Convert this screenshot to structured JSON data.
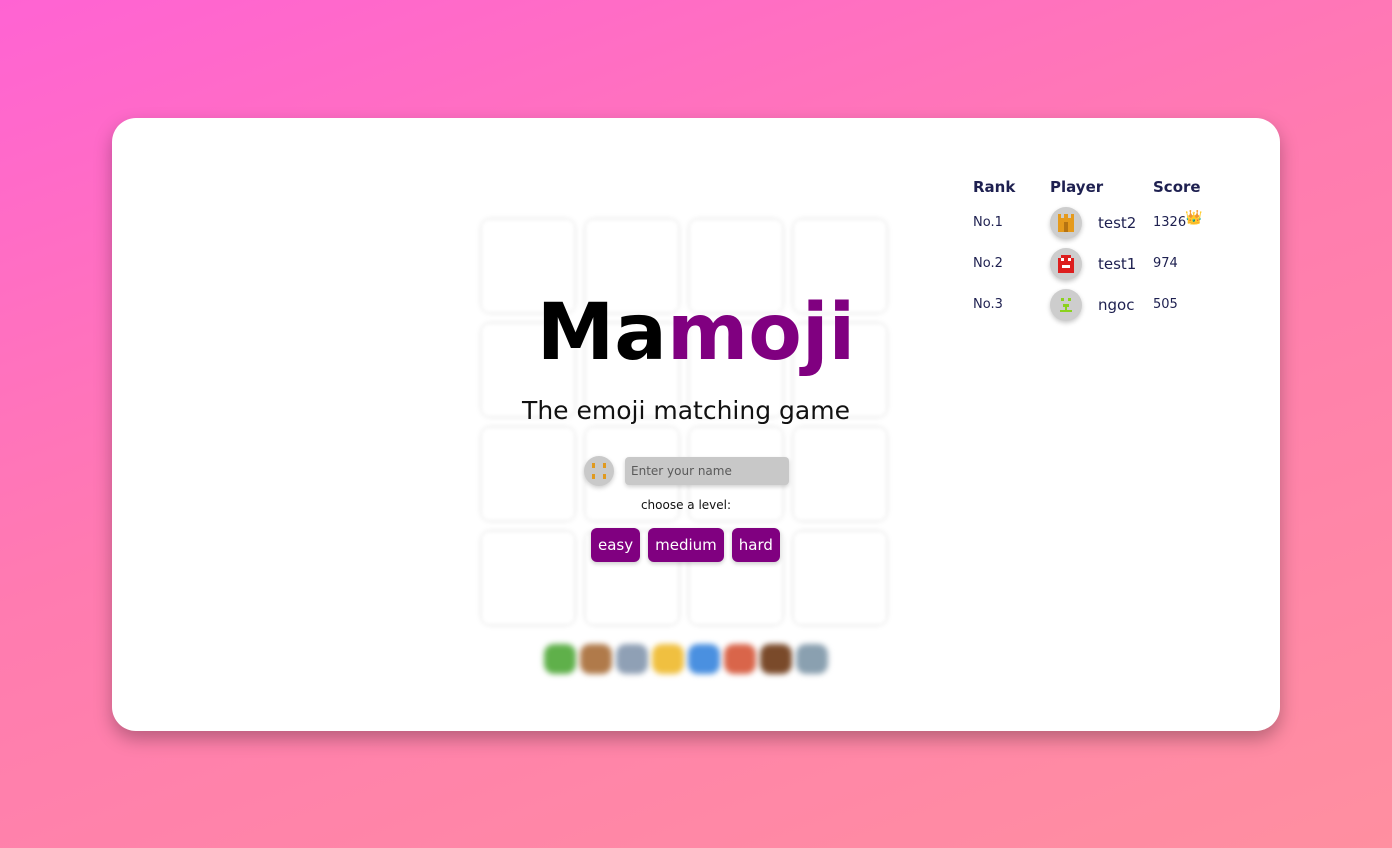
{
  "app": {
    "title_part1": "Ma",
    "title_part2": "moji",
    "subtitle": "The emoji matching game"
  },
  "player_form": {
    "name_placeholder": "Enter your name",
    "avatar_icon": "orange-pixel-face-avatar",
    "choose_label": "choose a level:",
    "levels": [
      "easy",
      "medium",
      "hard"
    ]
  },
  "leaderboard": {
    "headers": {
      "rank": "Rank",
      "player": "Player",
      "score": "Score"
    },
    "rows": [
      {
        "rank": "No.1",
        "player": "test2",
        "score": "1326",
        "avatar_icon": "orange-pixel-avatar",
        "badge_icon": "crown-icon",
        "badge": "👑"
      },
      {
        "rank": "No.2",
        "player": "test1",
        "score": "974",
        "avatar_icon": "red-pixel-avatar"
      },
      {
        "rank": "No.3",
        "player": "ngoc",
        "score": "505",
        "avatar_icon": "green-pixel-avatar"
      }
    ]
  },
  "background_emojis": [
    "dinosaur",
    "squirrel",
    "seal",
    "leopard",
    "dolphin",
    "rooster",
    "bison",
    "shark"
  ],
  "colors": {
    "accent": "#800080",
    "background_start": "#ff63d3",
    "background_end": "#ff8fa0",
    "text_dark": "#1e2050"
  }
}
